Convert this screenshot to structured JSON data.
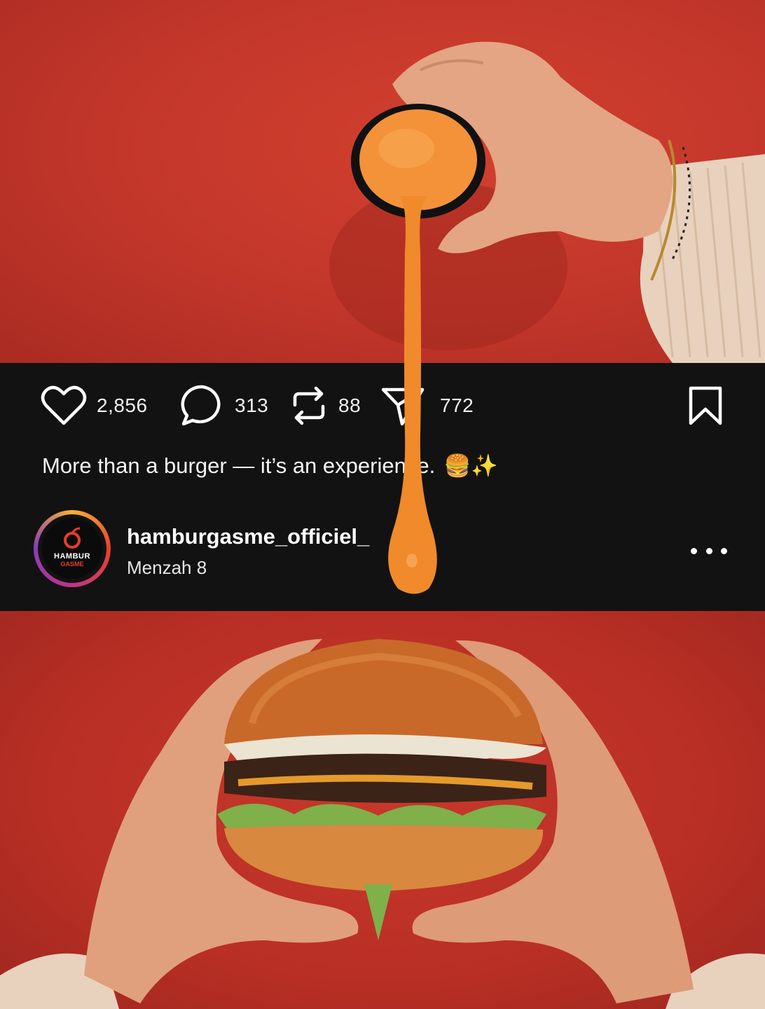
{
  "post": {
    "likes": "2,856",
    "comments": "313",
    "reposts": "88",
    "shares": "772",
    "caption": "More than a burger — it’s an experience.",
    "caption_emoji": "🍔✨",
    "username": "hamburgasme_officiel_",
    "location": "Menzah 8"
  },
  "avatar": {
    "logo_line1": "HAMBUR",
    "logo_line2": "GASME"
  },
  "icons": {
    "like": "heart-icon",
    "comment": "comment-bubble-icon",
    "repost": "repost-icon",
    "share": "share-paper-plane-icon",
    "save": "bookmark-icon",
    "more": "more-dots-icon"
  },
  "colors": {
    "background_red": "#c8372c",
    "bar_dark": "#121212",
    "sauce_orange": "#f08a2a",
    "avatar_ring": "#c13584"
  }
}
